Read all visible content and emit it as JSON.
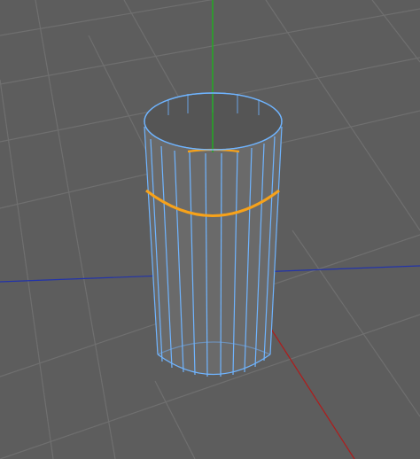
{
  "viewport": {
    "background_color": "#5d5d5d",
    "grid_color": "#6f6f6f",
    "x_axis_color": "#b01b1b",
    "y_axis_color": "#1fb01f",
    "z_axis_color": "#2233aa",
    "mesh_edge_color": "#6fb4ff",
    "selected_loop_color": "#f7a21a",
    "object": "cylinder",
    "radial_segments": 16,
    "height_segments": 2,
    "selected_edge_loops": 1
  }
}
